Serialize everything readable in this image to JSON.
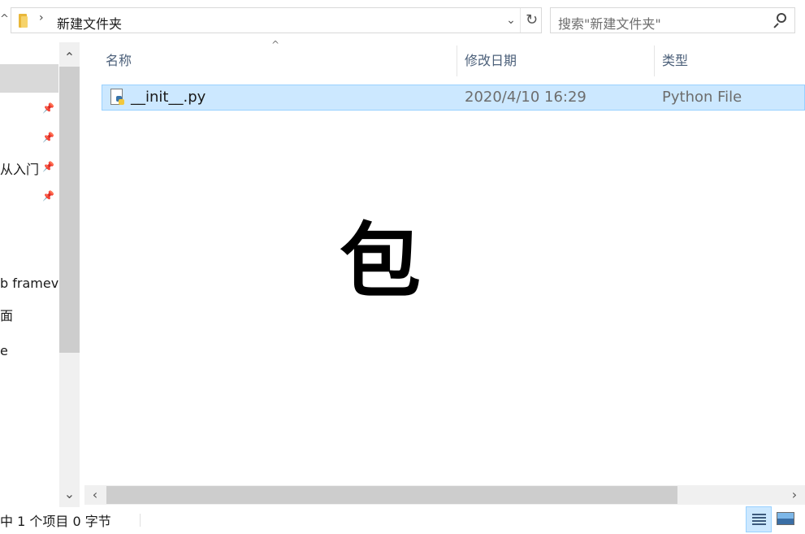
{
  "address_bar": {
    "separator": "›",
    "current_folder": "新建文件夹",
    "dropdown_glyph": "⌄",
    "refresh_glyph": "↻"
  },
  "search": {
    "placeholder": "搜索\"新建文件夹\""
  },
  "nav_pane": {
    "items": [
      {
        "label": "",
        "pinned": true
      },
      {
        "label": "",
        "pinned": true
      },
      {
        "label": "从入门",
        "pinned": true
      },
      {
        "label": "",
        "pinned": true
      },
      {
        "label": "b framev",
        "pinned": false
      },
      {
        "label": "面",
        "pinned": false
      },
      {
        "label": "e",
        "pinned": false
      }
    ],
    "pin_glyph": "📌",
    "scroll_up_glyph": "⌃",
    "scroll_down_glyph": "⌄"
  },
  "file_list": {
    "sort_glyph": "^",
    "columns": {
      "name": "名称",
      "modified": "修改日期",
      "type": "类型"
    },
    "rows": [
      {
        "name": "__init__.py",
        "modified": "2020/4/10 16:29",
        "type": "Python File",
        "selected": true
      }
    ]
  },
  "overlay_text": "包",
  "hscroll": {
    "left_glyph": "‹",
    "right_glyph": "›"
  },
  "status_bar": {
    "text": "中 1 个项目  0 字节"
  },
  "colors": {
    "selection_bg": "#cce8ff",
    "selection_border": "#99d1ff",
    "header_text": "#4c607a"
  }
}
